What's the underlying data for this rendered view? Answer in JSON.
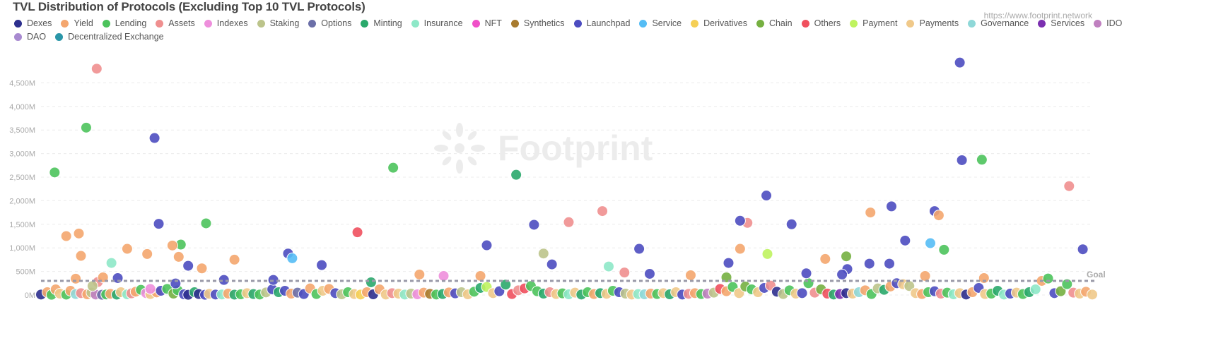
{
  "header": {
    "title": "TVL Distribution of Protocols (Excluding Top 10 TVL Protocols)",
    "url": "https://www.footprint.network",
    "watermark": "Footprint"
  },
  "chart_data": {
    "type": "scatter",
    "title": "TVL Distribution of Protocols (Excluding Top 10 TVL Protocols)",
    "xlabel": "",
    "ylabel": "",
    "ylim": [
      0,
      5000
    ],
    "y_ticks": [
      "0M",
      "500M",
      "1,000M",
      "1,500M",
      "2,000M",
      "2,500M",
      "3,000M",
      "3,500M",
      "4,000M",
      "4,500M"
    ],
    "y_tick_values": [
      0,
      500,
      1000,
      1500,
      2000,
      2500,
      3000,
      3500,
      4000,
      4500
    ],
    "grid": true,
    "legend_position": "top-left",
    "goal": {
      "label": "Goal",
      "value": 300
    },
    "legend": [
      {
        "name": "Dexes",
        "color": "#2d2f8e"
      },
      {
        "name": "Yield",
        "color": "#f4a66e"
      },
      {
        "name": "Lending",
        "color": "#4cc35c"
      },
      {
        "name": "Assets",
        "color": "#ef8f8f"
      },
      {
        "name": "Indexes",
        "color": "#ee8fdc"
      },
      {
        "name": "Staking",
        "color": "#bcc48b"
      },
      {
        "name": "Options",
        "color": "#6b6fa8"
      },
      {
        "name": "Minting",
        "color": "#2aa96b"
      },
      {
        "name": "Insurance",
        "color": "#8ee8c8"
      },
      {
        "name": "NFT",
        "color": "#f050c8"
      },
      {
        "name": "Synthetics",
        "color": "#a87b2e"
      },
      {
        "name": "Launchpad",
        "color": "#4c4cc0"
      },
      {
        "name": "Service",
        "color": "#55bdf5"
      },
      {
        "name": "Derivatives",
        "color": "#f5cf55"
      },
      {
        "name": "Chain",
        "color": "#76b041"
      },
      {
        "name": "Others",
        "color": "#f0505e"
      },
      {
        "name": "Payment",
        "color": "#bff35f"
      },
      {
        "name": "Payments",
        "color": "#f0c98a"
      },
      {
        "name": "Governance",
        "color": "#8fd8d8"
      },
      {
        "name": "Services",
        "color": "#7b2fb0"
      },
      {
        "name": "IDO",
        "color": "#c080c0"
      },
      {
        "name": "DAO",
        "color": "#a88ad0"
      },
      {
        "name": "Decentralized Exchange",
        "color": "#2a96a8"
      }
    ],
    "points": [
      [
        0,
        "Dexes",
        10
      ],
      [
        6,
        "Yield",
        60
      ],
      [
        10,
        "Lending",
        5
      ],
      [
        14,
        "Yield",
        120
      ],
      [
        18,
        "Payments",
        30
      ],
      [
        24,
        "Lending",
        8
      ],
      [
        28,
        "Yield",
        90
      ],
      [
        33,
        "Governance",
        20
      ],
      [
        38,
        "Assets",
        40
      ],
      [
        44,
        "Yield",
        15
      ],
      [
        48,
        "Staking",
        50
      ],
      [
        52,
        "IDO",
        10
      ],
      [
        58,
        "Options",
        5
      ],
      [
        62,
        "Lending",
        12
      ],
      [
        66,
        "Yield",
        25
      ],
      [
        72,
        "Minting",
        8
      ],
      [
        76,
        "Payments",
        60
      ],
      [
        82,
        "Insurance",
        15
      ],
      [
        86,
        "Assets",
        35
      ],
      [
        90,
        "Yield",
        70
      ],
      [
        95,
        "Lending",
        110
      ],
      [
        100,
        "Indexes",
        40
      ],
      [
        104,
        "Payments",
        20
      ],
      [
        110,
        "Yield",
        55
      ],
      [
        114,
        "Launchpad",
        90
      ],
      [
        120,
        "Lending",
        130
      ],
      [
        126,
        "Chain",
        30
      ],
      [
        130,
        "Lending",
        100
      ],
      [
        136,
        "Launchpad",
        15
      ],
      [
        140,
        "Dexes",
        5
      ],
      [
        146,
        "Minting",
        60
      ],
      [
        150,
        "Dexes",
        20
      ],
      [
        156,
        "Launchpad",
        5
      ],
      [
        160,
        "Payments",
        25
      ],
      [
        166,
        "Launchpad",
        10
      ],
      [
        172,
        "Insurance",
        12
      ],
      [
        178,
        "Yield",
        30
      ],
      [
        184,
        "Minting",
        8
      ],
      [
        190,
        "Lending",
        15
      ],
      [
        196,
        "Payments",
        40
      ],
      [
        202,
        "Minting",
        20
      ],
      [
        208,
        "Lending",
        10
      ],
      [
        214,
        "Staking",
        55
      ],
      [
        220,
        "Launchpad",
        120
      ],
      [
        226,
        "Minting",
        60
      ],
      [
        232,
        "Launchpad",
        90
      ],
      [
        238,
        "Yield",
        30
      ],
      [
        244,
        "Options",
        50
      ],
      [
        250,
        "Launchpad",
        20
      ],
      [
        256,
        "Yield",
        140
      ],
      [
        262,
        "Lending",
        20
      ],
      [
        268,
        "Payments",
        90
      ],
      [
        274,
        "Yield",
        130
      ],
      [
        280,
        "Launchpad",
        40
      ],
      [
        286,
        "Staking",
        15
      ],
      [
        292,
        "Lending",
        60
      ],
      [
        298,
        "Payments",
        20
      ],
      [
        304,
        "Derivatives",
        10
      ],
      [
        310,
        "Yield",
        60
      ],
      [
        316,
        "Dexes",
        15
      ],
      [
        322,
        "Yield",
        120
      ],
      [
        328,
        "Payments",
        10
      ],
      [
        334,
        "Assets",
        40
      ],
      [
        340,
        "Payments",
        30
      ],
      [
        346,
        "Insurance",
        10
      ],
      [
        352,
        "Staking",
        30
      ],
      [
        358,
        "Indexes",
        15
      ],
      [
        364,
        "Yield",
        50
      ],
      [
        370,
        "Synthetics",
        25
      ],
      [
        376,
        "Lending",
        10
      ],
      [
        382,
        "Minting",
        20
      ],
      [
        388,
        "Yield",
        55
      ],
      [
        394,
        "Launchpad",
        35
      ],
      [
        400,
        "Staking",
        60
      ],
      [
        406,
        "Payments",
        15
      ],
      [
        412,
        "Lending",
        70
      ],
      [
        418,
        "Minting",
        150
      ],
      [
        424,
        "Payment",
        170
      ],
      [
        430,
        "Payments",
        40
      ],
      [
        436,
        "Launchpad",
        80
      ],
      [
        442,
        "Minting",
        220
      ],
      [
        448,
        "Others",
        20
      ],
      [
        454,
        "Assets",
        100
      ],
      [
        460,
        "Others",
        140
      ],
      [
        466,
        "Lending",
        190
      ],
      [
        472,
        "Lending",
        80
      ],
      [
        478,
        "Minting",
        30
      ],
      [
        484,
        "Assets",
        60
      ],
      [
        490,
        "Payments",
        20
      ],
      [
        496,
        "Lending",
        35
      ],
      [
        502,
        "Insurance",
        15
      ],
      [
        508,
        "Payments",
        50
      ],
      [
        514,
        "Minting",
        10
      ],
      [
        520,
        "Lending",
        60
      ],
      [
        526,
        "Yield",
        20
      ],
      [
        532,
        "Minting",
        40
      ],
      [
        538,
        "Payments",
        25
      ],
      [
        544,
        "Lending",
        90
      ],
      [
        550,
        "Launchpad",
        60
      ],
      [
        556,
        "Staking",
        30
      ],
      [
        562,
        "Payments",
        10
      ],
      [
        568,
        "Insurance",
        20
      ],
      [
        574,
        "Governance",
        15
      ],
      [
        580,
        "Yield",
        30
      ],
      [
        586,
        "Lending",
        20
      ],
      [
        592,
        "Payments",
        40
      ],
      [
        598,
        "Minting",
        15
      ],
      [
        604,
        "Payments",
        60
      ],
      [
        610,
        "Launchpad",
        10
      ],
      [
        616,
        "Assets",
        25
      ],
      [
        622,
        "Yield",
        40
      ],
      [
        628,
        "Lending",
        20
      ],
      [
        634,
        "IDO",
        30
      ],
      [
        640,
        "Staking",
        50
      ],
      [
        646,
        "Others",
        130
      ],
      [
        652,
        "Yield",
        80
      ],
      [
        658,
        "Lending",
        170
      ],
      [
        664,
        "Payments",
        40
      ],
      [
        670,
        "Chain",
        180
      ],
      [
        676,
        "Lending",
        120
      ],
      [
        682,
        "Payments",
        60
      ],
      [
        688,
        "Launchpad",
        150
      ],
      [
        694,
        "Assets",
        200
      ],
      [
        700,
        "Dexes",
        70
      ],
      [
        706,
        "Staking",
        20
      ],
      [
        712,
        "Lending",
        100
      ],
      [
        718,
        "Payments",
        30
      ],
      [
        724,
        "Launchpad",
        40
      ],
      [
        730,
        "Lending",
        250
      ],
      [
        736,
        "Assets",
        50
      ],
      [
        742,
        "Chain",
        120
      ],
      [
        748,
        "Others",
        30
      ],
      [
        754,
        "Minting",
        10
      ],
      [
        760,
        "Services",
        20
      ],
      [
        766,
        "Dexes",
        40
      ],
      [
        772,
        "Payments",
        30
      ],
      [
        778,
        "Governance",
        60
      ],
      [
        784,
        "Yield",
        100
      ],
      [
        790,
        "Lending",
        20
      ],
      [
        796,
        "Staking",
        140
      ],
      [
        802,
        "Minting",
        110
      ],
      [
        808,
        "Yield",
        180
      ],
      [
        814,
        "Launchpad",
        250
      ],
      [
        820,
        "Payments",
        230
      ],
      [
        826,
        "Staking",
        190
      ],
      [
        832,
        "Payments",
        40
      ],
      [
        838,
        "Yield",
        20
      ],
      [
        844,
        "Lending",
        60
      ],
      [
        850,
        "Launchpad",
        80
      ],
      [
        856,
        "Assets",
        30
      ],
      [
        862,
        "Lending",
        50
      ],
      [
        868,
        "Insurance",
        15
      ],
      [
        874,
        "Payments",
        40
      ],
      [
        880,
        "Dexes",
        10
      ],
      [
        886,
        "Yield",
        60
      ],
      [
        892,
        "Launchpad",
        150
      ],
      [
        898,
        "Payments",
        20
      ],
      [
        904,
        "Lending",
        30
      ],
      [
        910,
        "Minting",
        90
      ],
      [
        916,
        "Insurance",
        10
      ],
      [
        922,
        "Launchpad",
        30
      ],
      [
        928,
        "Payments",
        50
      ],
      [
        934,
        "Lending",
        20
      ],
      [
        940,
        "Minting",
        60
      ],
      [
        946,
        "Insurance",
        120
      ],
      [
        952,
        "Yield",
        300
      ],
      [
        958,
        "Lending",
        350
      ],
      [
        964,
        "Launchpad",
        40
      ],
      [
        970,
        "Chain",
        80
      ],
      [
        976,
        "Lending",
        230
      ],
      [
        982,
        "Assets",
        50
      ],
      [
        988,
        "Payments",
        30
      ],
      [
        994,
        "Yield",
        70
      ],
      [
        1000,
        "Payments",
        10
      ],
      [
        13,
        "Lending",
        2600
      ],
      [
        43,
        "Lending",
        3550
      ],
      [
        133,
        "Lending",
        1070
      ],
      [
        157,
        "Lending",
        1520
      ],
      [
        335,
        "Lending",
        2700
      ],
      [
        895,
        "Lending",
        2870
      ],
      [
        859,
        "Lending",
        960
      ],
      [
        766,
        "Chain",
        820
      ],
      [
        652,
        "Chain",
        375
      ],
      [
        452,
        "Minting",
        2550
      ],
      [
        314,
        "Minting",
        270
      ],
      [
        53,
        "Assets",
        4800
      ],
      [
        534,
        "Assets",
        1780
      ],
      [
        502,
        "Assets",
        1545
      ],
      [
        672,
        "Assets",
        1530
      ],
      [
        978,
        "Assets",
        2310
      ],
      [
        555,
        "Assets",
        477
      ],
      [
        54,
        "Assets",
        275
      ],
      [
        301,
        "Others",
        1330
      ],
      [
        108,
        "Launchpad",
        3330
      ],
      [
        112,
        "Launchpad",
        1510
      ],
      [
        140,
        "Launchpad",
        620
      ],
      [
        874,
        "Launchpad",
        4930
      ],
      [
        876,
        "Launchpad",
        2860
      ],
      [
        690,
        "Launchpad",
        2110
      ],
      [
        665,
        "Launchpad",
        1575
      ],
      [
        714,
        "Launchpad",
        1500
      ],
      [
        809,
        "Launchpad",
        1880
      ],
      [
        850,
        "Launchpad",
        1780
      ],
      [
        822,
        "Launchpad",
        1155
      ],
      [
        424,
        "Launchpad",
        1055
      ],
      [
        469,
        "Launchpad",
        1490
      ],
      [
        569,
        "Launchpad",
        980
      ],
      [
        788,
        "Launchpad",
        665
      ],
      [
        807,
        "Launchpad",
        665
      ],
      [
        767,
        "Launchpad",
        550
      ],
      [
        991,
        "Launchpad",
        970
      ],
      [
        654,
        "Launchpad",
        680
      ],
      [
        486,
        "Launchpad",
        650
      ],
      [
        267,
        "Launchpad",
        635
      ],
      [
        235,
        "Launchpad",
        880
      ],
      [
        579,
        "Launchpad",
        450
      ],
      [
        728,
        "Launchpad",
        460
      ],
      [
        762,
        "Launchpad",
        435
      ],
      [
        73,
        "Launchpad",
        360
      ],
      [
        174,
        "Launchpad",
        320
      ],
      [
        221,
        "Launchpad",
        320
      ],
      [
        128,
        "Launchpad",
        245
      ],
      [
        24,
        "Yield",
        1250
      ],
      [
        36,
        "Yield",
        1305
      ],
      [
        38,
        "Yield",
        830
      ],
      [
        82,
        "Yield",
        980
      ],
      [
        101,
        "Yield",
        870
      ],
      [
        125,
        "Yield",
        1050
      ],
      [
        131,
        "Yield",
        810
      ],
      [
        665,
        "Yield",
        980
      ],
      [
        789,
        "Yield",
        1750
      ],
      [
        854,
        "Yield",
        1690
      ],
      [
        746,
        "Yield",
        765
      ],
      [
        153,
        "Yield",
        565
      ],
      [
        184,
        "Yield",
        750
      ],
      [
        360,
        "Yield",
        435
      ],
      [
        418,
        "Yield",
        405
      ],
      [
        618,
        "Yield",
        420
      ],
      [
        841,
        "Yield",
        405
      ],
      [
        897,
        "Yield",
        360
      ],
      [
        33,
        "Yield",
        347
      ],
      [
        59,
        "Yield",
        375
      ],
      [
        239,
        "Service",
        780
      ],
      [
        846,
        "Service",
        1100
      ],
      [
        478,
        "Staking",
        880
      ],
      [
        49,
        "Staking",
        190
      ],
      [
        691,
        "Payment",
        870
      ],
      [
        67,
        "Insurance",
        680
      ],
      [
        540,
        "Insurance",
        605
      ],
      [
        383,
        "Indexes",
        405
      ],
      [
        104,
        "Indexes",
        130
      ]
    ]
  }
}
